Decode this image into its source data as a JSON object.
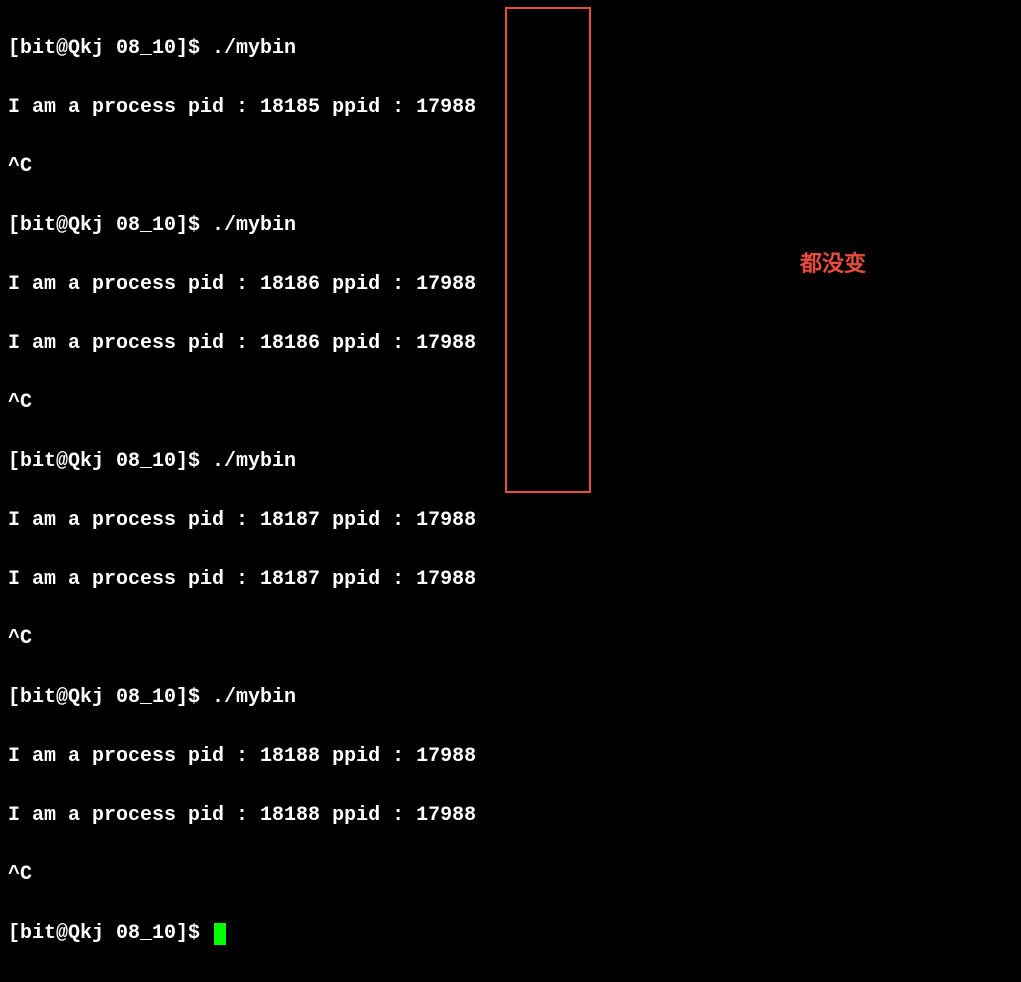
{
  "prompt": "[bit@Qkj 08_10]$ ",
  "command": "./mybin",
  "runs": [
    {
      "pid": "18185",
      "ppid": "17988",
      "line_count": 1
    },
    {
      "pid": "18186",
      "ppid": "17988",
      "line_count": 2
    },
    {
      "pid": "18187",
      "ppid": "17988",
      "line_count": 2
    },
    {
      "pid": "18188",
      "ppid": "17988",
      "line_count": 2
    }
  ],
  "interrupt": "^C",
  "process_prefix": "I am a process pid : ",
  "ppid_label": " ppid : ",
  "annotation_text": "都没变",
  "highlight_color": "#e74c3c"
}
